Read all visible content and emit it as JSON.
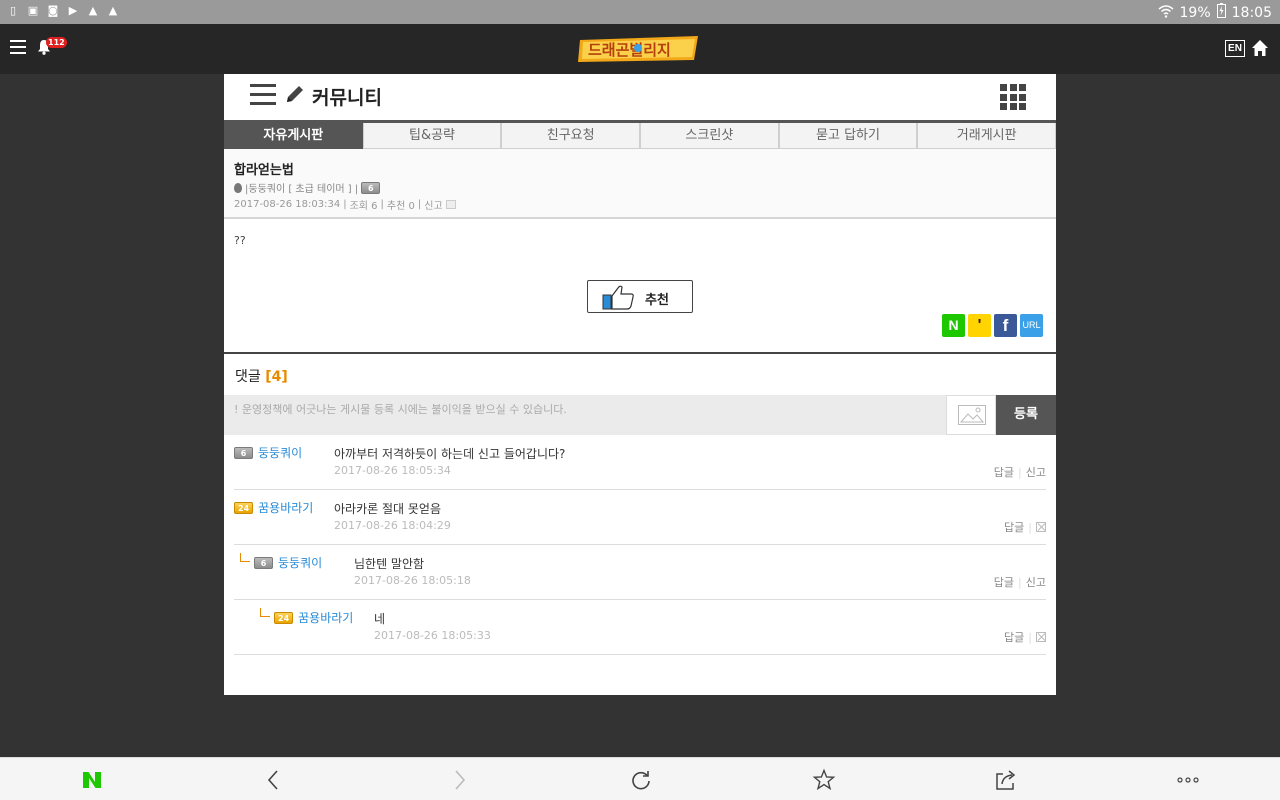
{
  "statusbar": {
    "battery": "19%",
    "time": "18:05",
    "left_icons": [
      "screen-rotate-icon",
      "image-icon",
      "camera-icon",
      "youtube-icon",
      "warning-icon",
      "warning-icon"
    ]
  },
  "appbar": {
    "notification_count": "112",
    "logo_text": "드래곤빌리지",
    "lang_label": "EN"
  },
  "community": {
    "title": "커뮤니티",
    "tabs": [
      "자유게시판",
      "팁&공략",
      "친구요청",
      "스크린샷",
      "묻고 답하기",
      "거래게시판"
    ],
    "active_tab": 0
  },
  "post": {
    "title": "합라얻는법",
    "author_line": "|둥둥쿼이 [ 초급 테이머 ] |",
    "author_level": "6",
    "datetime": "2017-08-26 18:03:34",
    "views": "조회 6",
    "recommends": "추천 0",
    "report": "신고",
    "body": "??",
    "like_label": "추천",
    "share": {
      "naver": "N",
      "kakao": "'",
      "facebook": "f",
      "url": "URL"
    }
  },
  "comments_section": {
    "label": "댓글",
    "count": "[4]",
    "placeholder": "! 운영정책에 어긋나는 게시물 등록 시에는 불이익을 받으실 수 있습니다.",
    "submit_label": "등록",
    "reply_label": "답글",
    "report_label": "신고",
    "items": [
      {
        "level": "6",
        "nick": "둥둥쿼이",
        "text": "아까부터 저격하듯이 하는데 신고 들어갑니다?",
        "date": "2017-08-26 18:05:34"
      },
      {
        "level": "24",
        "nick": "꿈용바라기",
        "text": "아라카론 절대 못얻음",
        "date": "2017-08-26 18:04:29"
      },
      {
        "level": "6",
        "nick": "둥둥쿼이",
        "text": "님한텐 말안함",
        "date": "2017-08-26 18:05:18"
      },
      {
        "level": "24",
        "nick": "꿈용바라기",
        "text": "네",
        "date": "2017-08-26 18:05:33"
      }
    ]
  },
  "bottombar": {
    "icons": [
      "naver-icon",
      "back-icon",
      "forward-icon",
      "refresh-icon",
      "bookmark-star-icon",
      "share-icon",
      "more-icon"
    ],
    "naver_label": "N"
  },
  "colors": {
    "accent_orange": "#e88a00",
    "link_blue": "#2a8bd6",
    "tab_active": "#555555",
    "appbar": "#262626"
  }
}
